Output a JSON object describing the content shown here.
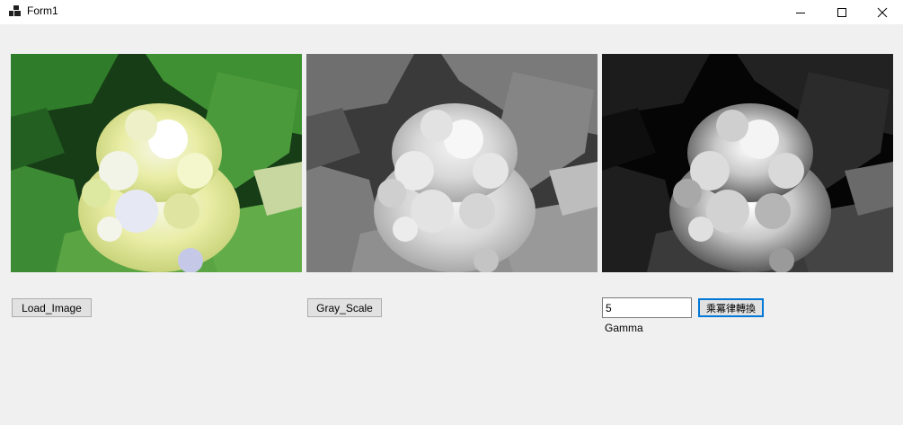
{
  "window": {
    "title": "Form1"
  },
  "caption_buttons": [
    "minimize",
    "maximize",
    "close"
  ],
  "pictures": [
    {
      "name": "original",
      "tone": "color"
    },
    {
      "name": "gray-scale",
      "tone": "grayscale"
    },
    {
      "name": "gamma-result",
      "tone": "grayscale-high-contrast"
    }
  ],
  "controls": {
    "load_label": "Load_Image",
    "gray_label": "Gray_Scale",
    "gamma_value": "5",
    "gamma_button_label": "乘冪律轉換",
    "gamma_caption": "Gamma"
  }
}
